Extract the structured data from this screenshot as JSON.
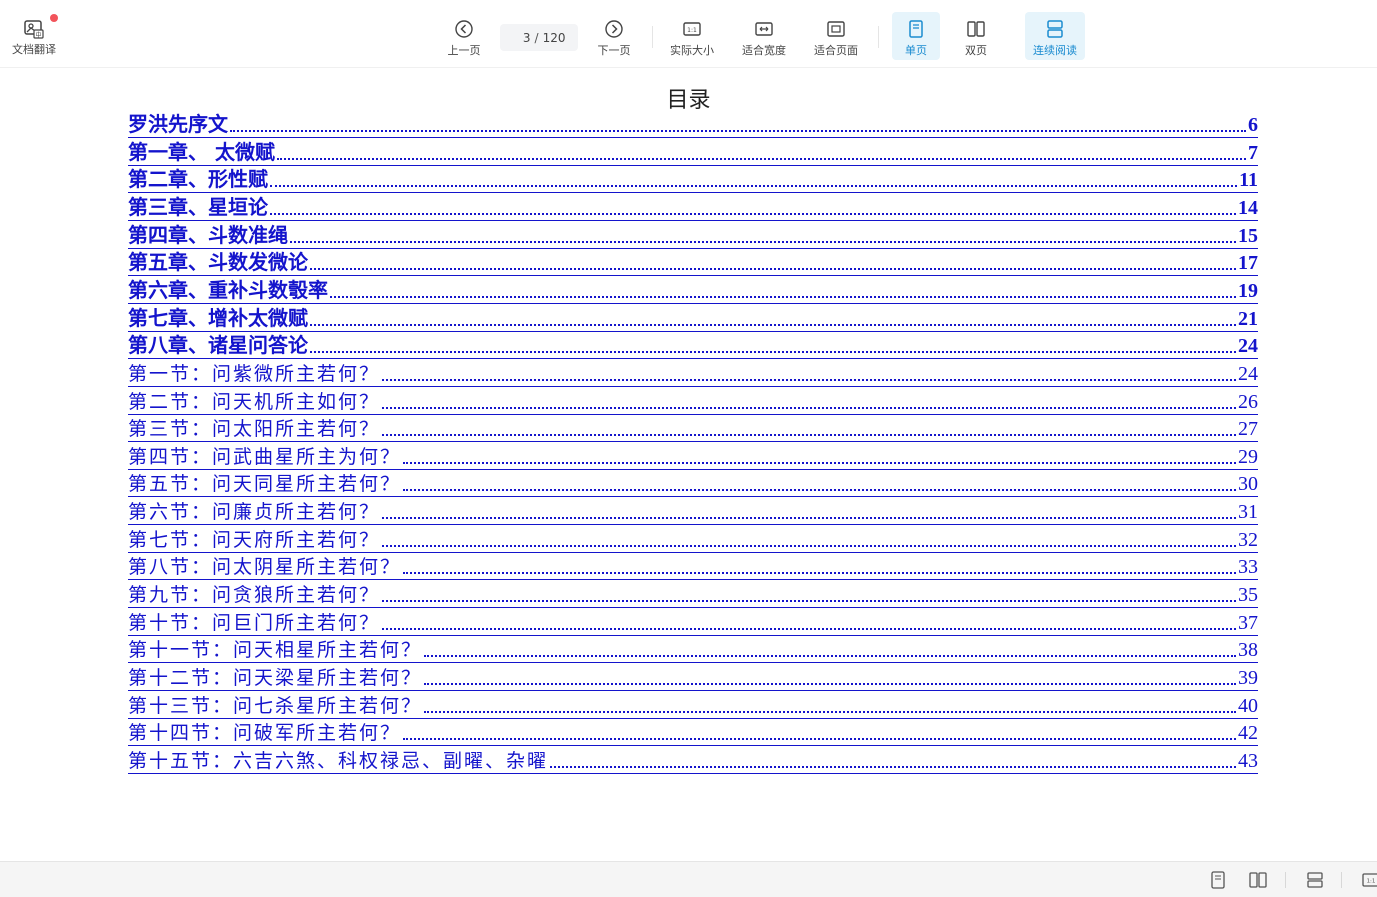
{
  "toolbar": {
    "translate_label": "文档翻译",
    "prev_label": "上一页",
    "current_page": "3",
    "page_separator": "/",
    "total_pages": "120",
    "next_label": "下一页",
    "actual_size_label": "实际大小",
    "fit_width_label": "适合宽度",
    "fit_page_label": "适合页面",
    "single_page_label": "单页",
    "double_page_label": "双页",
    "continuous_label": "连续阅读",
    "accent_color": "#1a8bd0",
    "badge_color": "#f2545b"
  },
  "toc": {
    "title": "目录",
    "link_color": "#1414cc",
    "entries": [
      {
        "text": "罗洪先序文",
        "page": "6",
        "kind": "chap"
      },
      {
        "text": "第一章、 太微赋",
        "page": "7",
        "kind": "chap"
      },
      {
        "text": "第二章、形性赋",
        "page": "11",
        "kind": "chap"
      },
      {
        "text": "第三章、星垣论",
        "page": "14",
        "kind": "chap"
      },
      {
        "text": "第四章、斗数准绳",
        "page": "15",
        "kind": "chap"
      },
      {
        "text": "第五章、斗数发微论",
        "page": "17",
        "kind": "chap"
      },
      {
        "text": "第六章、重补斗数彀率",
        "page": "19",
        "kind": "chap"
      },
      {
        "text": "第七章、增补太微赋",
        "page": "21",
        "kind": "chap"
      },
      {
        "text": "第八章、诸星问答论",
        "page": "24",
        "kind": "chap"
      },
      {
        "text": "第一节：问紫微所主若何？",
        "page": "24",
        "kind": "sec"
      },
      {
        "text": "第二节：问天机所主如何？",
        "page": "26",
        "kind": "sec"
      },
      {
        "text": "第三节：问太阳所主若何？",
        "page": "27",
        "kind": "sec"
      },
      {
        "text": "第四节：问武曲星所主为何？",
        "page": "29",
        "kind": "sec"
      },
      {
        "text": "第五节：问天同星所主若何？",
        "page": "30",
        "kind": "sec"
      },
      {
        "text": "第六节：问廉贞所主若何？",
        "page": "31",
        "kind": "sec"
      },
      {
        "text": "第七节：问天府所主若何？",
        "page": "32",
        "kind": "sec"
      },
      {
        "text": "第八节：问太阴星所主若何？",
        "page": "33",
        "kind": "sec"
      },
      {
        "text": "第九节：问贪狼所主若何？",
        "page": "35",
        "kind": "sec"
      },
      {
        "text": "第十节：问巨门所主若何？",
        "page": "37",
        "kind": "sec"
      },
      {
        "text": "第十一节：问天相星所主若何？",
        "page": "38",
        "kind": "sec"
      },
      {
        "text": "第十二节：问天梁星所主若何？",
        "page": "39",
        "kind": "sec"
      },
      {
        "text": "第十三节：问七杀星所主若何？",
        "page": "40",
        "kind": "sec"
      },
      {
        "text": "第十四节：问破军所主若何？",
        "page": "42",
        "kind": "sec"
      },
      {
        "text": "第十五节：六吉六煞、科权禄忌、副曜、杂曜",
        "page": "43",
        "kind": "sec"
      }
    ]
  },
  "statusbar": {
    "icons": [
      "single-page-icon",
      "double-page-icon",
      "continuous-icon",
      "actual-size-icon"
    ]
  }
}
